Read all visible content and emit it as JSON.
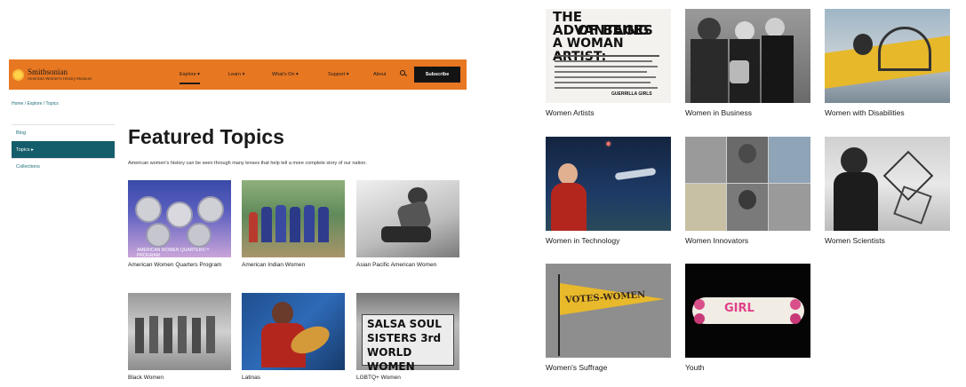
{
  "header": {
    "logo_title": "Smithsonian",
    "logo_subtitle": "American Women's History Museum",
    "nav": {
      "explore": "Explore ▾",
      "learn": "Learn ▾",
      "whats_on": "What's On ▾",
      "support": "Support ▾",
      "about": "About"
    },
    "subscribe_label": "Subscribe"
  },
  "breadcrumb": "Home / Explore / Topics",
  "sidebar": {
    "items": [
      {
        "label": "Blog"
      },
      {
        "label": "Topics ▸"
      },
      {
        "label": "Collections"
      }
    ]
  },
  "main": {
    "title": "Featured Topics",
    "intro": "American women's history can be seen through many lenses that help tell a more complete story of our nation."
  },
  "left_topics": [
    {
      "label": "American Women Quarters Program",
      "caption": "AMERICAN WOMEN QUARTERS™ PROGRAM"
    },
    {
      "label": "American Indian Women"
    },
    {
      "label": "Asian Pacific American Women"
    },
    {
      "label": "Black Women"
    },
    {
      "label": "Latinas"
    },
    {
      "label": "LGBTQ+ Women",
      "caption_lines": [
        "SALSA SOUL",
        "SISTERS 3rd",
        "WORLD WOMEN"
      ]
    }
  ],
  "right_topics": [
    {
      "label": "Women Artists",
      "poster_lines": [
        "THE ADVANTAGES",
        "OF BEING",
        "A WOMAN ARTIST:"
      ],
      "poster_credit": "GUERRILLA GIRLS"
    },
    {
      "label": "Women in Business"
    },
    {
      "label": "Women with Disabilities"
    },
    {
      "label": "Women in Technology"
    },
    {
      "label": "Women Innovators"
    },
    {
      "label": "Women Scientists"
    },
    {
      "label": "Women's Suffrage",
      "pennant": "VOTES-WOMEN"
    },
    {
      "label": "Youth",
      "skateboard": "GIRL"
    }
  ],
  "colors": {
    "header_orange": "#e87722",
    "sidebar_active": "#145d6b",
    "link_teal": "#1f6f7a"
  }
}
